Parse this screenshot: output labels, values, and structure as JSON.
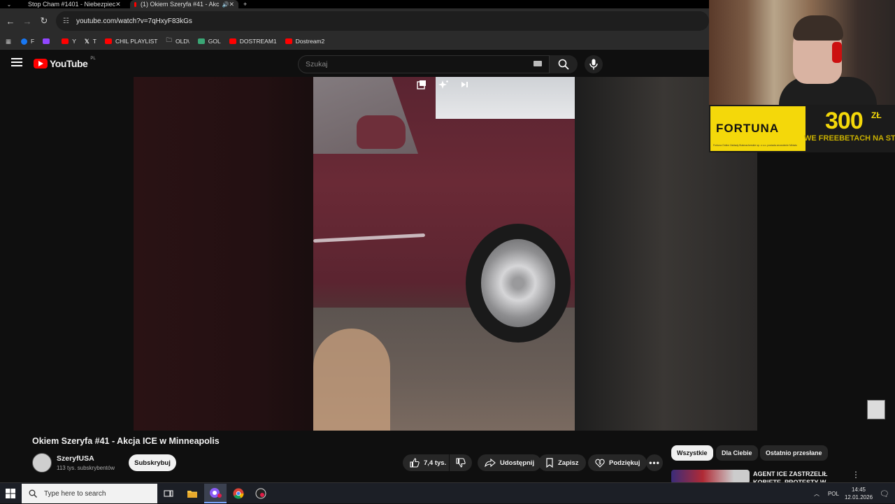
{
  "browser": {
    "tabs": [
      {
        "title": "Stop Cham #1401 - Niebezpiec",
        "active": false
      },
      {
        "title": "(1) Okiem Szeryfa #41 - Akc",
        "active": true
      }
    ],
    "new_tab": "+",
    "url": "youtube.com/watch?v=7qHxyF83kGs",
    "bookmarks": [
      {
        "label": "F",
        "color": "#1877f2"
      },
      {
        "label": "",
        "color": "#9146ff"
      },
      {
        "label": "Y",
        "color": "#ff0000"
      },
      {
        "label": "T",
        "color": "#ffffff"
      },
      {
        "label": "CHIL PLAYLIST",
        "color": "#ff0000"
      },
      {
        "label": "OLD\\",
        "color": "folder"
      },
      {
        "label": "GOL",
        "color": "#3aa675"
      },
      {
        "label": "DOSTREAM1",
        "color": "#ff0000"
      },
      {
        "label": "Dostream2",
        "color": "#ff0000"
      }
    ]
  },
  "youtube": {
    "logo_text": "YouTube",
    "region": "PL",
    "search_placeholder": "Szukaj"
  },
  "video": {
    "title": "Okiem Szeryfa #41 - Akcja ICE w Minneapolis",
    "channel": "SzeryfUSA",
    "subscribers": "113 tys. subskrybentów",
    "subscribe_label": "Subskrybuj",
    "likes": "7,4 tys.",
    "share_label": "Udostępnij",
    "save_label": "Zapisz",
    "thanks_label": "Podziękuj"
  },
  "sidebar": {
    "chips": [
      "Wszystkie",
      "Dla Ciebie",
      "Ostatnio przesłane"
    ],
    "reco_title": "AGENT ICE ZASTRZELIŁ KOBIETĘ. PROTESTY W"
  },
  "ad": {
    "brand": "FORTUNA",
    "amount": "300",
    "currency": "ZŁ",
    "promo": "WE FREEBETACH NA START",
    "fine_print": "Fortuna Online Zakłady Bukmacherskie sp. z o.o. posiada zezwolenie Ministra Finansów. Hazard wiąże się z ryzykiem."
  },
  "taskbar": {
    "search_placeholder": "Type here to search",
    "language": "POL",
    "time": "14:45",
    "date": "12.01.2026"
  },
  "colors": {
    "accent": "#ff0000",
    "fortuna_yellow": "#f4d80a"
  }
}
